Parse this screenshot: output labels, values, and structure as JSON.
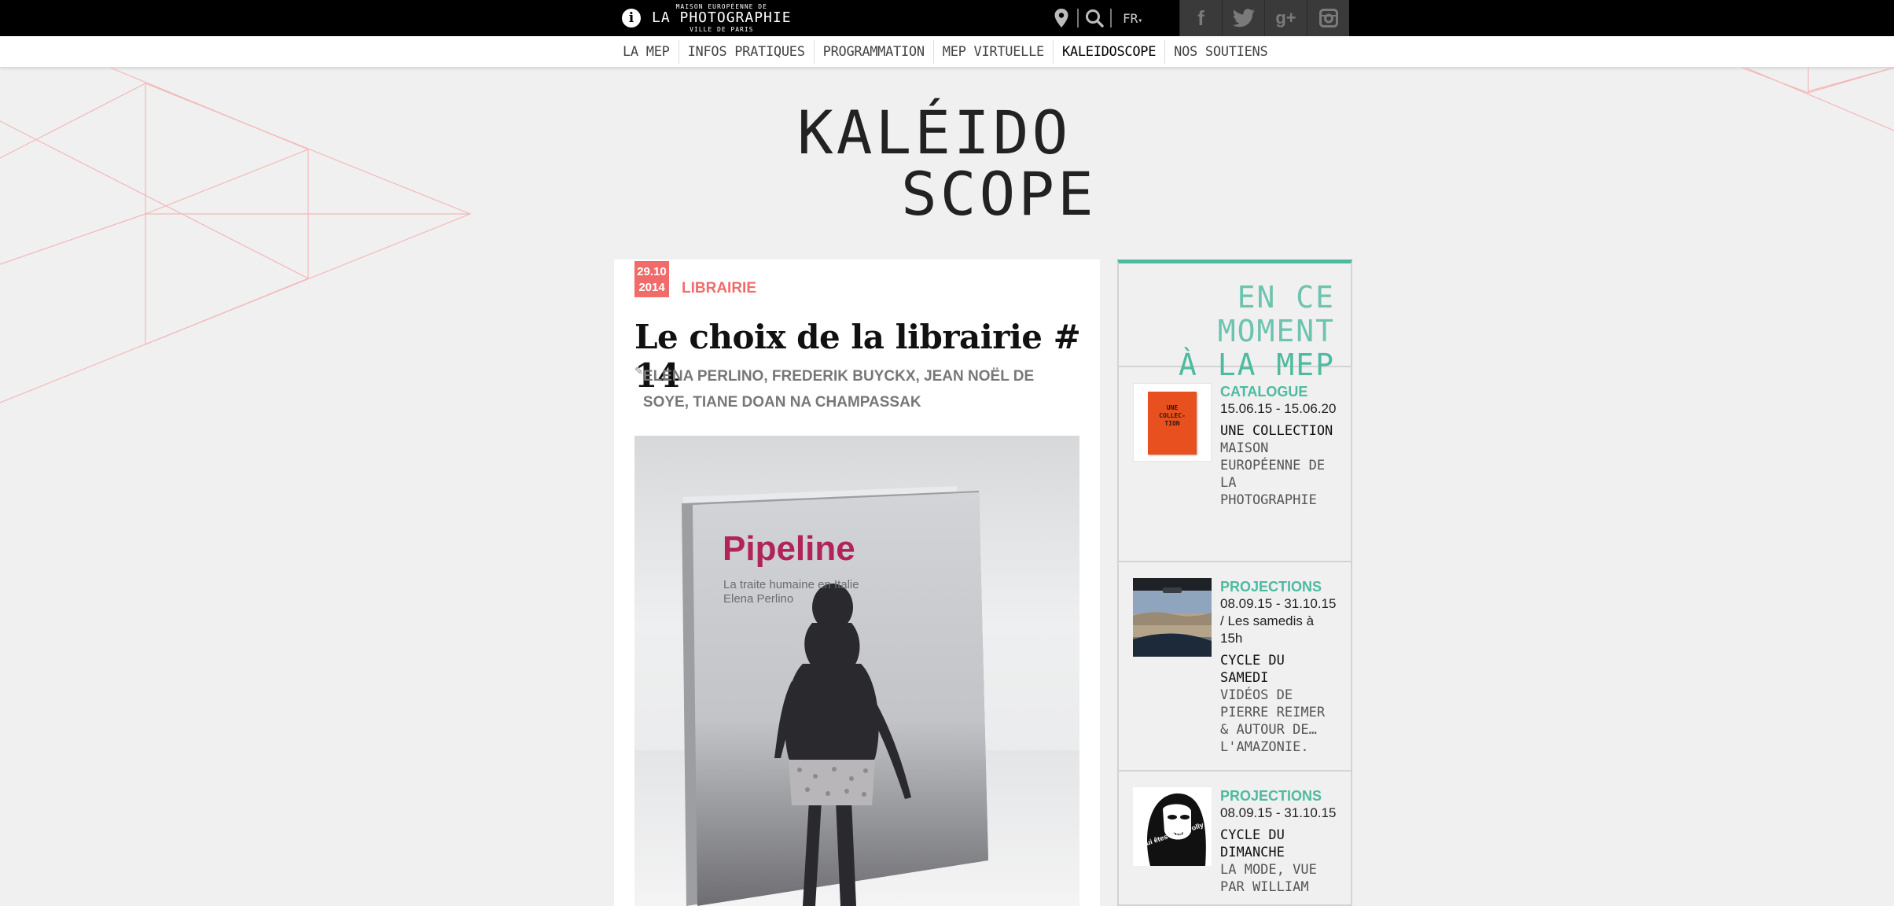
{
  "header": {
    "logo": {
      "line1": "MAISON EUROPÉENNE DE",
      "line2": "LA PHOTOGRAPHIE",
      "line3": "VILLE DE PARIS"
    },
    "language": "FR",
    "icons": [
      "info-icon",
      "location-pin-icon",
      "search-icon",
      "facebook-icon",
      "twitter-icon",
      "google-plus-icon",
      "instagram-icon"
    ]
  },
  "nav": {
    "items": [
      {
        "label": "LA MEP"
      },
      {
        "label": "INFOS PRATIQUES"
      },
      {
        "label": "PROGRAMMATION"
      },
      {
        "label": "MEP VIRTUELLE"
      },
      {
        "label": "KALEIDOSCOPE"
      },
      {
        "label": "NOS SOUTIENS"
      }
    ],
    "active": "KALEIDOSCOPE"
  },
  "page_title": {
    "line1": "KALÉIDO",
    "line2": "SCOPE"
  },
  "article": {
    "date_line1": "29.10",
    "date_line2": "2014",
    "category": "LIBRAIRIE",
    "title": "Le choix de la librairie # 14",
    "authors": "ELENA PERLINO, FREDERIK BUYCKX, JEAN NOËL DE SOYE, TIANE DOAN NA CHAMPASSAK",
    "book": {
      "title": "Pipeline",
      "subtitle": "La traite humaine en Italie",
      "author": "Elena Perlino"
    }
  },
  "sidebar": {
    "heading_line1": "EN CE MOMENT",
    "heading_line2": "À LA MEP",
    "items": [
      {
        "category": "CATALOGUE",
        "dates": "15.06.15 - 15.06.20",
        "title": "UNE COLLECTION",
        "subtitle": "MAISON EUROPÉENNE DE LA PHOTOGRAPHIE",
        "thumb_text": "UNE COLLEC-TION"
      },
      {
        "category": "PROJECTIONS",
        "dates": "08.09.15 - 31.10.15 / Les samedis à 15h",
        "title": "CYCLE DU SAMEDI",
        "subtitle": "VIDÉOS DE PIERRE REIMER & AUTOUR DE… L'AMAZONIE."
      },
      {
        "category": "PROJECTIONS",
        "dates": "08.09.15 - 31.10.15",
        "title": "CYCLE DU DIMANCHE",
        "subtitle": "LA MODE, VUE PAR WILLIAM",
        "thumb_text": "Qui êtes-vous Polly Maggoo ?"
      }
    ]
  },
  "colors": {
    "accent_red": "#f26b6b",
    "accent_green": "#4cbba0",
    "book_title": "#b0245a"
  }
}
